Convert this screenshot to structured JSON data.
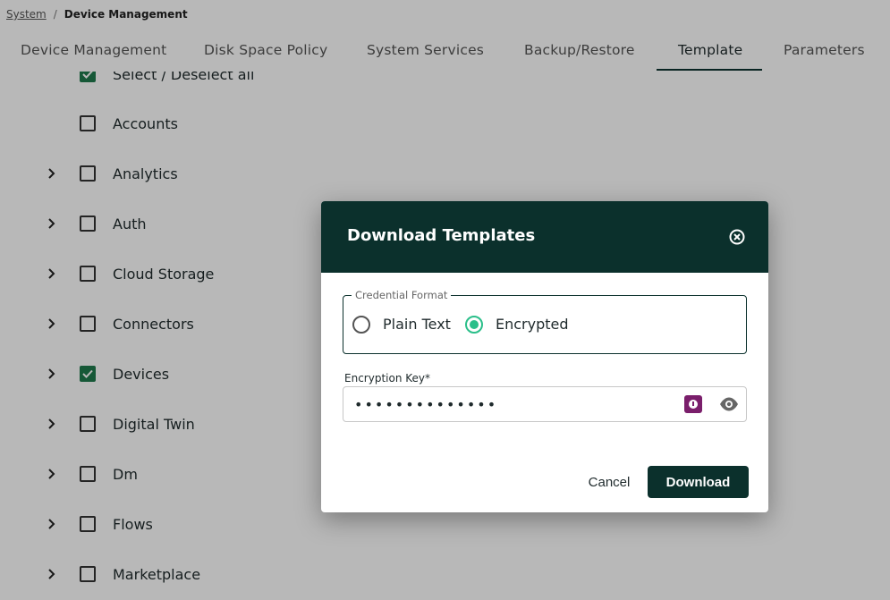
{
  "breadcrumb": {
    "root": "System",
    "separator": "/",
    "current": "Device Management"
  },
  "tabs": [
    {
      "label": "Device Management",
      "active": false
    },
    {
      "label": "Disk Space Policy",
      "active": false
    },
    {
      "label": "System Services",
      "active": false
    },
    {
      "label": "Backup/Restore",
      "active": false
    },
    {
      "label": "Template",
      "active": true
    },
    {
      "label": "Parameters",
      "active": false
    }
  ],
  "tree": {
    "select_all": {
      "label": "Select / Deselect all",
      "checked": true
    },
    "items": [
      {
        "label": "Accounts",
        "checked": false,
        "expandable": false
      },
      {
        "label": "Analytics",
        "checked": false,
        "expandable": true
      },
      {
        "label": "Auth",
        "checked": false,
        "expandable": true
      },
      {
        "label": "Cloud Storage",
        "checked": false,
        "expandable": true
      },
      {
        "label": "Connectors",
        "checked": false,
        "expandable": true
      },
      {
        "label": "Devices",
        "checked": true,
        "expandable": true
      },
      {
        "label": "Digital Twin",
        "checked": false,
        "expandable": true
      },
      {
        "label": "Dm",
        "checked": false,
        "expandable": true
      },
      {
        "label": "Flows",
        "checked": false,
        "expandable": true
      },
      {
        "label": "Marketplace",
        "checked": false,
        "expandable": true
      }
    ]
  },
  "modal": {
    "title": "Download Templates",
    "credential_format": {
      "legend": "Credential Format",
      "options": [
        {
          "label": "Plain Text",
          "selected": false
        },
        {
          "label": "Encrypted",
          "selected": true
        }
      ]
    },
    "encryption_key": {
      "label": "Encryption Key*",
      "value": "••••••••••••••"
    },
    "cancel_label": "Cancel",
    "download_label": "Download"
  },
  "colors": {
    "header_bg": "#0b302c",
    "accent_green": "#2bbf8a",
    "checkbox_green": "#1f7a4d",
    "password_manager": "#7a1e6b"
  },
  "icons": {
    "close": "close-circle-icon",
    "eye": "eye-icon",
    "password_manager": "password-manager-icon",
    "chevron": "chevron-right-icon"
  }
}
